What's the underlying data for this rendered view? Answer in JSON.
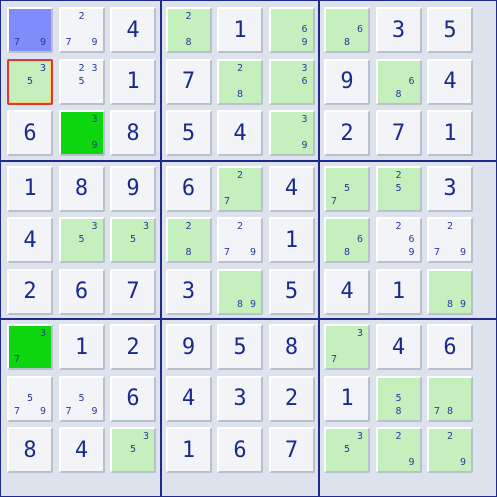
{
  "board": {
    "rows": [
      [
        {
          "c": [
            7,
            9
          ],
          "s": "sel-blue"
        },
        {
          "c": [
            2,
            7,
            9
          ]
        },
        {
          "v": "4"
        },
        {
          "c": [
            2,
            8
          ],
          "s": "hl"
        },
        {
          "v": "1"
        },
        {
          "c": [
            6,
            9
          ],
          "s": "hl"
        },
        {
          "c": [
            6,
            8
          ],
          "s": "hl"
        },
        {
          "v": "3"
        },
        {
          "v": "5"
        }
      ],
      [
        {
          "c": [
            3,
            5
          ],
          "s": "hl",
          "focus": true
        },
        {
          "c": [
            2,
            3,
            5
          ]
        },
        {
          "v": "1"
        },
        {
          "v": "7"
        },
        {
          "c": [
            2,
            8
          ],
          "s": "hl"
        },
        {
          "c": [
            3,
            6
          ],
          "s": "hl"
        },
        {
          "v": "9"
        },
        {
          "c": [
            6,
            8
          ],
          "s": "hl"
        },
        {
          "v": "4"
        }
      ],
      [
        {
          "v": "6"
        },
        {
          "c": [
            3,
            9
          ],
          "s": "sel-green"
        },
        {
          "v": "8"
        },
        {
          "v": "5"
        },
        {
          "v": "4"
        },
        {
          "c": [
            3,
            9
          ],
          "s": "hl"
        },
        {
          "v": "2"
        },
        {
          "v": "7"
        },
        {
          "v": "1"
        }
      ],
      [
        {
          "v": "1"
        },
        {
          "v": "8"
        },
        {
          "v": "9"
        },
        {
          "v": "6"
        },
        {
          "c": [
            2,
            7
          ],
          "s": "hl"
        },
        {
          "v": "4"
        },
        {
          "c": [
            5,
            7
          ],
          "s": "hl"
        },
        {
          "c": [
            2,
            5
          ],
          "s": "hl"
        },
        {
          "v": "3"
        }
      ],
      [
        {
          "v": "4"
        },
        {
          "c": [
            3,
            5
          ],
          "s": "hl"
        },
        {
          "c": [
            3,
            5
          ],
          "s": "hl"
        },
        {
          "c": [
            2,
            8
          ],
          "s": "hl"
        },
        {
          "c": [
            2,
            7,
            9
          ]
        },
        {
          "v": "1"
        },
        {
          "c": [
            6,
            8
          ],
          "s": "hl"
        },
        {
          "c": [
            2,
            6,
            9
          ]
        },
        {
          "c": [
            2,
            7,
            9
          ]
        }
      ],
      [
        {
          "v": "2"
        },
        {
          "v": "6"
        },
        {
          "v": "7"
        },
        {
          "v": "3"
        },
        {
          "c": [
            8,
            9
          ],
          "s": "hl"
        },
        {
          "v": "5"
        },
        {
          "v": "4"
        },
        {
          "v": "1"
        },
        {
          "c": [
            8,
            9
          ],
          "s": "hl"
        }
      ],
      [
        {
          "c": [
            3,
            7
          ],
          "s": "sel-green"
        },
        {
          "v": "1"
        },
        {
          "v": "2"
        },
        {
          "v": "9"
        },
        {
          "v": "5"
        },
        {
          "v": "8"
        },
        {
          "c": [
            3,
            7
          ],
          "s": "hl"
        },
        {
          "v": "4"
        },
        {
          "v": "6"
        }
      ],
      [
        {
          "c": [
            5,
            7,
            9
          ]
        },
        {
          "c": [
            5,
            7,
            9
          ]
        },
        {
          "v": "6"
        },
        {
          "v": "4"
        },
        {
          "v": "3"
        },
        {
          "v": "2"
        },
        {
          "v": "1"
        },
        {
          "c": [
            5,
            8
          ],
          "s": "hl"
        },
        {
          "c": [
            7,
            8
          ],
          "s": "hl"
        }
      ],
      [
        {
          "v": "8"
        },
        {
          "v": "4"
        },
        {
          "c": [
            3,
            5
          ],
          "s": "hl"
        },
        {
          "v": "1"
        },
        {
          "v": "6"
        },
        {
          "v": "7"
        },
        {
          "c": [
            3,
            5
          ],
          "s": "hl"
        },
        {
          "c": [
            2,
            9
          ],
          "s": "hl"
        },
        {
          "c": [
            2,
            9
          ],
          "s": "hl"
        }
      ]
    ]
  }
}
